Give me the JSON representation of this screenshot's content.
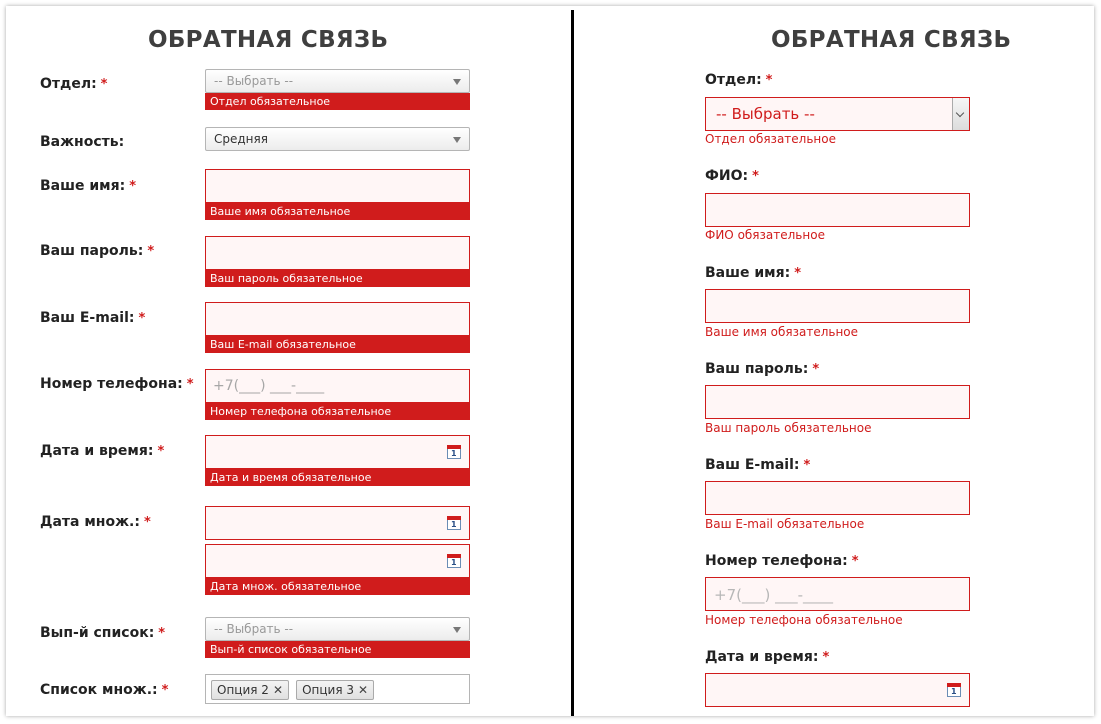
{
  "left": {
    "title": "ОБРАТНАЯ СВЯЗЬ",
    "required_mark": "*",
    "department": {
      "label": "Отдел:",
      "value": "-- Выбрать --",
      "error": "Отдел обязательное"
    },
    "importance": {
      "label": "Важность:",
      "value": "Средняя"
    },
    "name": {
      "label": "Ваше имя:",
      "error": "Ваше имя обязательное"
    },
    "password": {
      "label": "Ваш пароль:",
      "error": "Ваш пароль обязательное"
    },
    "email": {
      "label": "Ваш E-mail:",
      "error": "Ваш E-mail обязательное"
    },
    "phone": {
      "label": "Номер телефона:",
      "placeholder": "+7(___) ___-____",
      "error": "Номер телефона обязательное"
    },
    "datetime": {
      "label": "Дата и время:",
      "error": "Дата и время обязательное"
    },
    "multi_date": {
      "label": "Дата множ.:",
      "error": "Дата множ. обязательное"
    },
    "dropdown": {
      "label": "Вып-й список:",
      "value": "-- Выбрать --",
      "error": "Вып-й список обязательное"
    },
    "multi_list": {
      "label": "Список множ.:",
      "tags": [
        "Опция 2",
        "Опция 3"
      ]
    },
    "calendar_digit": "1"
  },
  "right": {
    "title": "ОБРАТНАЯ СВЯЗЬ",
    "required_mark": "*",
    "department": {
      "label": "Отдел:",
      "value": "-- Выбрать --",
      "error": "Отдел обязательное"
    },
    "fio": {
      "label": "ФИО:",
      "error": "ФИО обязательное"
    },
    "name": {
      "label": "Ваше имя:",
      "error": "Ваше имя обязательное"
    },
    "password": {
      "label": "Ваш пароль:",
      "error": "Ваш пароль обязательное"
    },
    "email": {
      "label": "Ваш E-mail:",
      "error": "Ваш E-mail обязательное"
    },
    "phone": {
      "label": "Номер телефона:",
      "placeholder": "+7(___) ___-____",
      "error": "Номер телефона обязательное"
    },
    "datetime": {
      "label": "Дата и время:"
    },
    "calendar_digit": "1"
  },
  "colors": {
    "error": "#d01c1c",
    "field_bg": "#fff6f6",
    "title": "#3f3f3f"
  }
}
